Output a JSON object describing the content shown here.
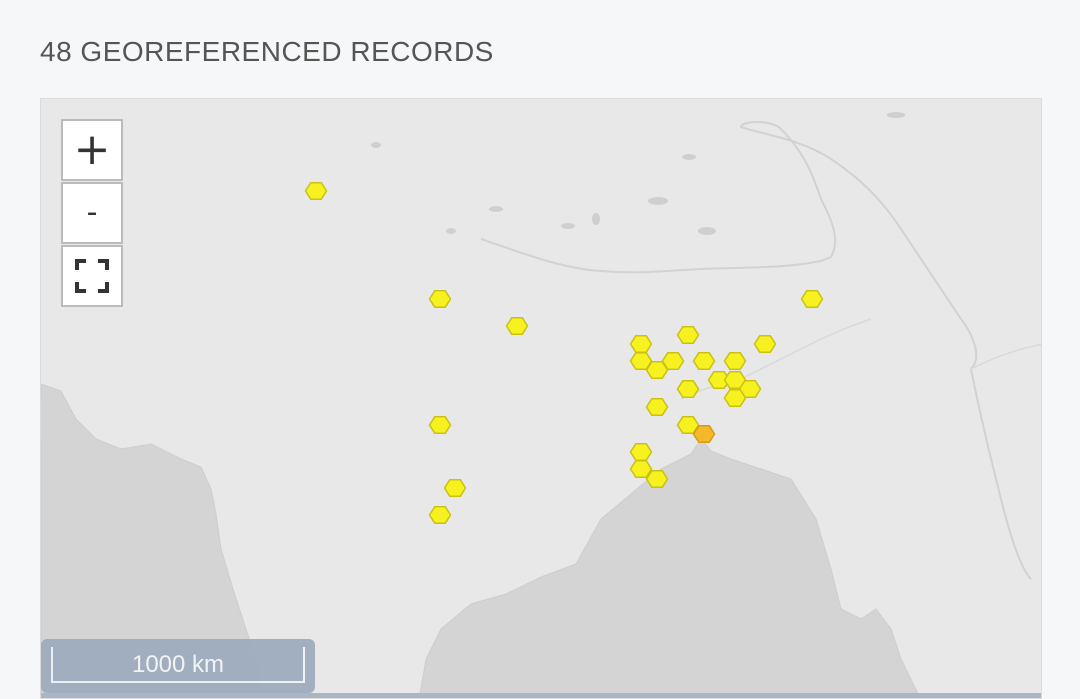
{
  "header": {
    "title": "48 GEOREFERENCED RECORDS"
  },
  "map": {
    "controls": {
      "zoom_in_label": "+",
      "zoom_out_label": "-",
      "fullscreen_icon": "fullscreen-icon"
    },
    "scale": {
      "label": "1000 km"
    },
    "colors": {
      "background": "#e8e8e8",
      "land": "#d4d4d4",
      "boundary": "#cfcfcf",
      "hex_low": "#f7f21f",
      "hex_high": "#f5b82a"
    },
    "hexbins": [
      {
        "level": "low"
      },
      {
        "level": "low"
      },
      {
        "level": "low"
      },
      {
        "level": "low"
      },
      {
        "level": "low"
      },
      {
        "level": "low"
      },
      {
        "level": "low"
      },
      {
        "level": "low"
      },
      {
        "level": "low"
      },
      {
        "level": "low"
      },
      {
        "level": "low"
      },
      {
        "level": "low"
      },
      {
        "level": "low"
      },
      {
        "level": "low"
      },
      {
        "level": "low"
      },
      {
        "level": "low"
      },
      {
        "level": "low"
      },
      {
        "level": "low"
      },
      {
        "level": "low"
      },
      {
        "level": "low"
      },
      {
        "level": "low"
      },
      {
        "level": "low"
      },
      {
        "level": "high"
      },
      {
        "level": "low"
      },
      {
        "level": "low"
      },
      {
        "level": "low"
      },
      {
        "level": "low"
      },
      {
        "level": "low"
      }
    ]
  }
}
